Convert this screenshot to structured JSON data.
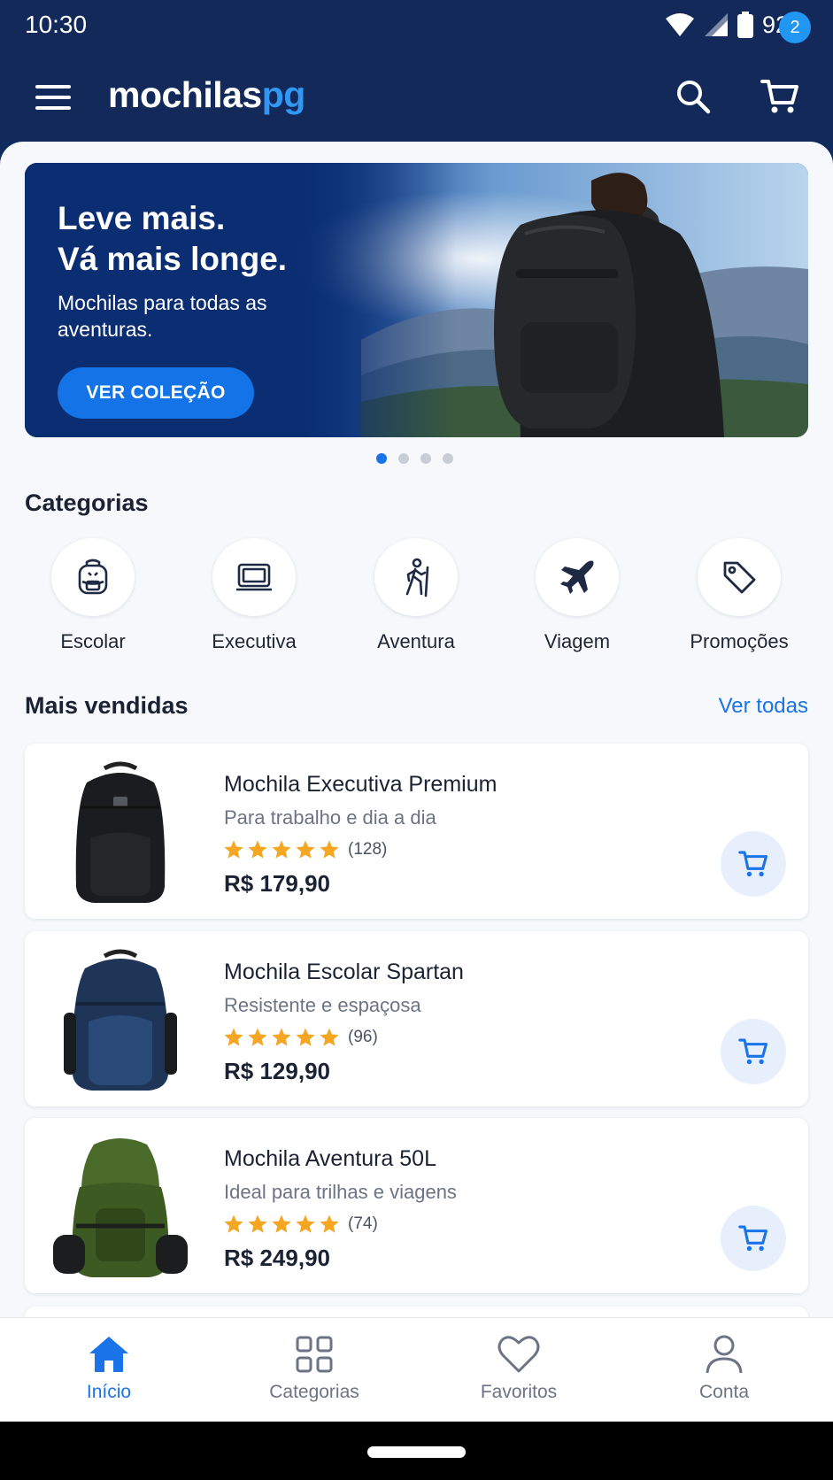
{
  "status_bar": {
    "time": "10:30",
    "battery": "92%"
  },
  "app_bar": {
    "logo_main": "mochilas",
    "logo_accent": "pg",
    "cart_count": "2"
  },
  "banner": {
    "title_line1": "Leve mais.",
    "title_line2": "Vá mais longe.",
    "subtitle": "Mochilas para todas as aventuras.",
    "cta": "VER COLEÇÃO",
    "slides": 4,
    "active_slide": 1
  },
  "categories": {
    "title": "Categorias",
    "items": [
      {
        "label": "Escolar",
        "icon": "school-backpack-icon"
      },
      {
        "label": "Executiva",
        "icon": "laptop-icon"
      },
      {
        "label": "Aventura",
        "icon": "hiker-icon"
      },
      {
        "label": "Viagem",
        "icon": "airplane-icon"
      },
      {
        "label": "Promoções",
        "icon": "tag-icon"
      }
    ]
  },
  "best_sellers": {
    "title": "Mais vendidas",
    "see_all": "Ver todas",
    "products": [
      {
        "name": "Mochila Executiva Premium",
        "description": "Para trabalho e dia a dia",
        "rating": 5,
        "reviews": "(128)",
        "price": "R$ 179,90",
        "color": "#1b1c1f"
      },
      {
        "name": "Mochila Escolar Spartan",
        "description": "Resistente e espaçosa",
        "rating": 5,
        "reviews": "(96)",
        "price": "R$ 129,90",
        "color": "#1f3558"
      },
      {
        "name": "Mochila Aventura 50L",
        "description": "Ideal para trilhas e viagens",
        "rating": 5,
        "reviews": "(74)",
        "price": "R$ 249,90",
        "color": "#3d5a22"
      }
    ]
  },
  "bottom_nav": {
    "items": [
      {
        "label": "Início",
        "icon": "home-icon",
        "active": true
      },
      {
        "label": "Categorias",
        "icon": "grid-icon",
        "active": false
      },
      {
        "label": "Favoritos",
        "icon": "heart-icon",
        "active": false
      },
      {
        "label": "Conta",
        "icon": "user-icon",
        "active": false
      }
    ]
  },
  "colors": {
    "primary": "#1a73e8",
    "header": "#12295a",
    "star": "#f5a623"
  }
}
